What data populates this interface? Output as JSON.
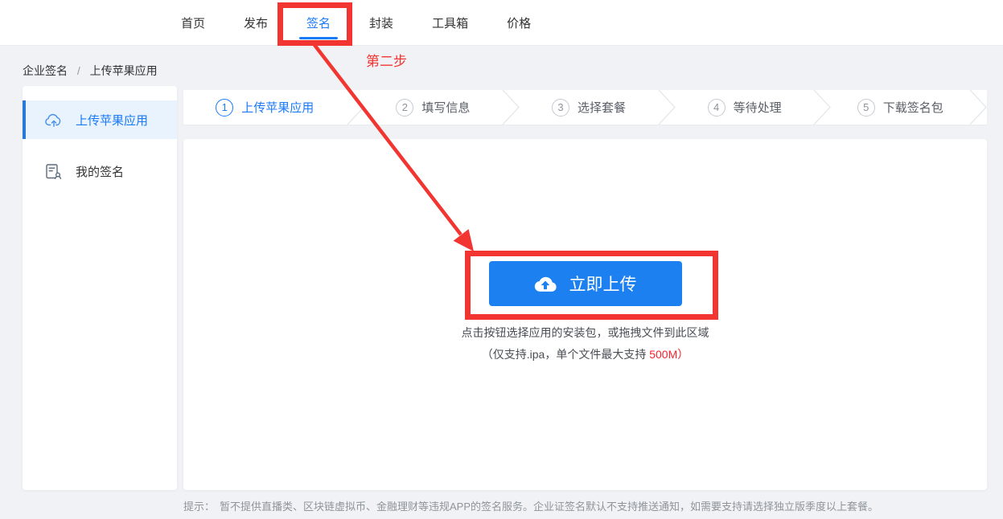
{
  "topnav": {
    "items": [
      {
        "label": "首页",
        "active": false
      },
      {
        "label": "发布",
        "active": false
      },
      {
        "label": "签名",
        "active": true
      },
      {
        "label": "封装",
        "active": false
      },
      {
        "label": "工具箱",
        "active": false
      },
      {
        "label": "价格",
        "active": false
      }
    ]
  },
  "breadcrumb": {
    "items": [
      "企业签名",
      "上传苹果应用"
    ],
    "separator": "/"
  },
  "sidebar": {
    "items": [
      {
        "label": "上传苹果应用",
        "icon": "cloud-upload-icon",
        "active": true
      },
      {
        "label": "我的签名",
        "icon": "signature-doc-icon",
        "active": false
      }
    ]
  },
  "steps": [
    {
      "num": "1",
      "label": "上传苹果应用",
      "active": true
    },
    {
      "num": "2",
      "label": "填写信息",
      "active": false
    },
    {
      "num": "3",
      "label": "选择套餐",
      "active": false
    },
    {
      "num": "4",
      "label": "等待处理",
      "active": false
    },
    {
      "num": "5",
      "label": "下载签名包",
      "active": false
    }
  ],
  "upload": {
    "button_label": "立即上传",
    "button_icon": "cloud-upload-icon",
    "hint_line1": "点击按钮选择应用的安装包，或拖拽文件到此区域",
    "hint_line2_prefix": "（仅支持.ipa，单个文件最大支持 ",
    "hint_line2_highlight": "500M",
    "hint_line2_suffix": "）"
  },
  "footer": {
    "tip_label": "提示：",
    "tip_text": "暂不提供直播类、区块链虚拟币、金融理财等违规APP的签名服务。企业证签名默认不支持推送通知，如需要支持请选择独立版季度以上套餐。"
  },
  "annotations": {
    "step_label": "第二步"
  },
  "colors": {
    "accent": "#1a7af8",
    "button": "#1c80f0",
    "annotation": "#f23530",
    "highlight": "#f5222d",
    "sidebar_active_bg": "#e8f3fd",
    "sidebar_active_bar": "#2979d9",
    "page_bg": "#f0f2f5"
  }
}
